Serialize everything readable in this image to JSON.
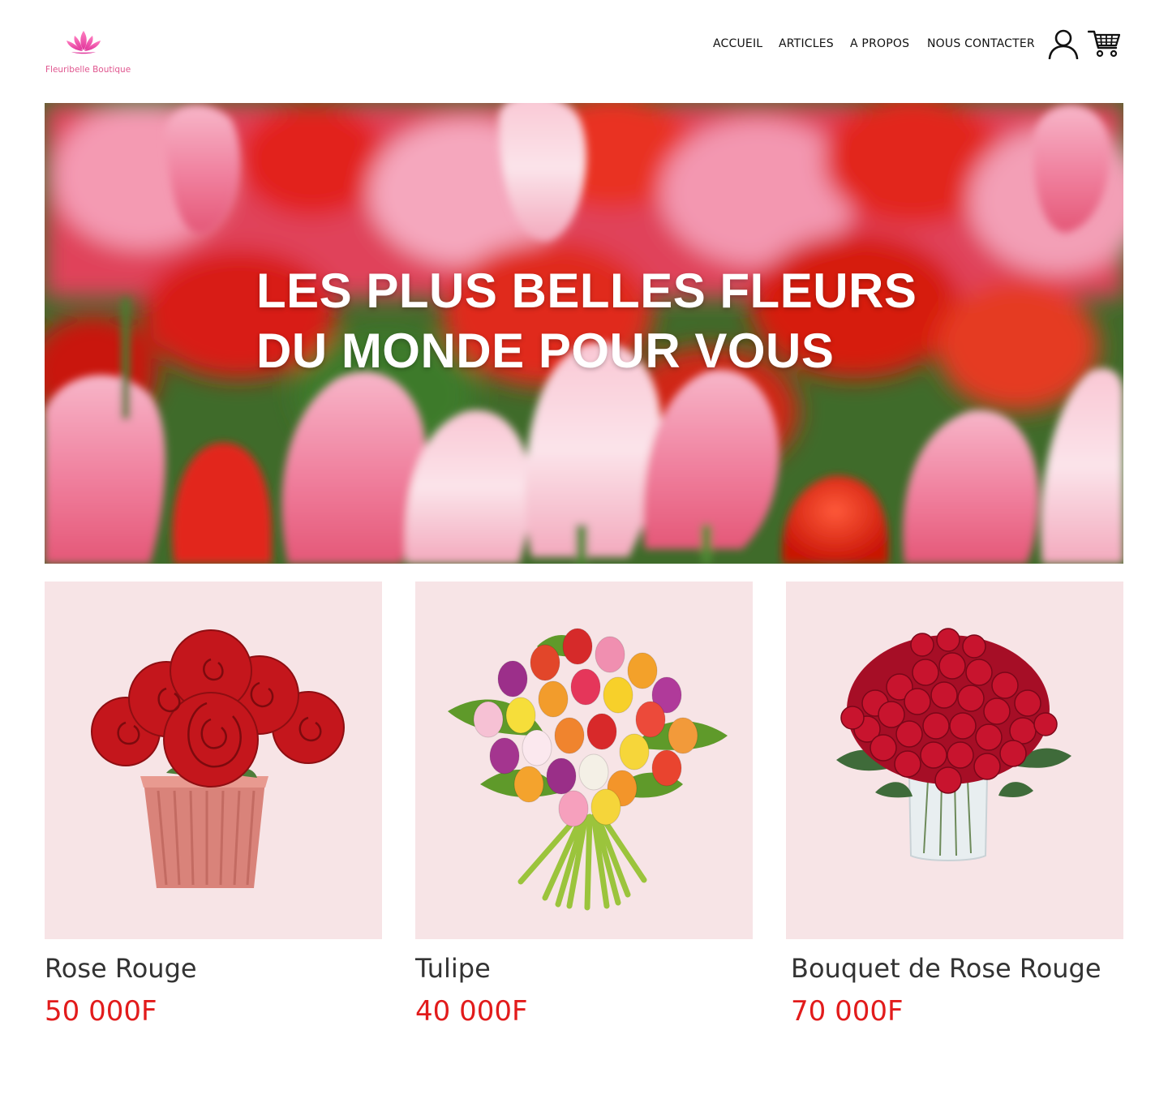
{
  "brand": {
    "name": "Fleuribelle Boutique",
    "logo_icon": "lotus-icon",
    "accent_color": "#e0568f"
  },
  "nav": {
    "items": [
      {
        "label": "ACCUEIL"
      },
      {
        "label": "ARTICLES"
      },
      {
        "label": "A PROPOS"
      },
      {
        "label": "NOUS CONTACTER"
      }
    ],
    "user_icon": "user-icon",
    "cart_icon": "cart-icon"
  },
  "hero": {
    "line1": "LES PLUS BELLES FLEURS",
    "line2": "DU MONDE POUR VOUS",
    "image": "tulip-field"
  },
  "products": [
    {
      "name": "Rose Rouge",
      "price": "50 000F",
      "image": "red-roses-in-pot"
    },
    {
      "name": "Tulipe",
      "price": "40 000F",
      "image": "tulip-bouquet"
    },
    {
      "name": "Bouquet de Rose Rouge",
      "price": "70 000F",
      "image": "red-rose-bouquet-vase"
    }
  ],
  "colors": {
    "price": "#e21b1b",
    "product_bg": "#f7e4e6",
    "text": "#333333"
  }
}
